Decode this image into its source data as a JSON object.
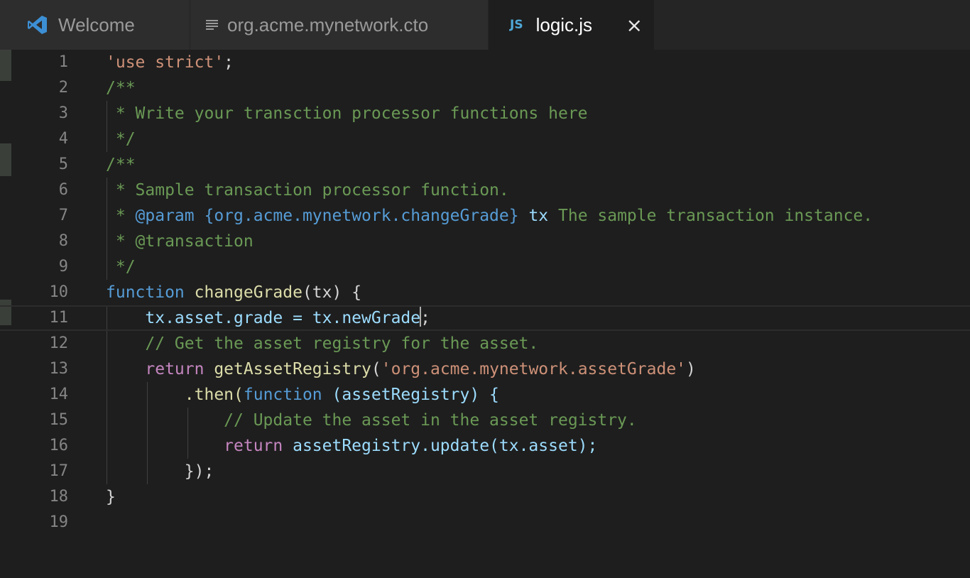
{
  "tabs": [
    {
      "label": "Welcome",
      "icon": "vscode-logo-icon",
      "active": false
    },
    {
      "label": "org.acme.mynetwork.cto",
      "icon": "text-file-icon",
      "active": false
    },
    {
      "label": "logic.js",
      "icon": "js-file-icon",
      "icon_text": "JS",
      "active": true,
      "close": "×"
    }
  ],
  "editor": {
    "line_numbers": [
      "1",
      "2",
      "3",
      "4",
      "5",
      "6",
      "7",
      "8",
      "9",
      "10",
      "11",
      "12",
      "13",
      "14",
      "15",
      "16",
      "17",
      "18",
      "19"
    ],
    "code": {
      "l1_str": "'use strict'",
      "l1_punct": ";",
      "l2": "/**",
      "l3": " * Write your transction processor functions here",
      "l4": " */",
      "l5": "/**",
      "l6": " * Sample transaction processor function.",
      "l7_a": " * ",
      "l7_tag": "@param",
      "l7_type": " {org.acme.mynetwork.changeGrade}",
      "l7_name": " tx",
      "l7_desc": " The sample transaction instance.",
      "l8": " * @transaction",
      "l9": " */",
      "l10_kw": "function",
      "l10_fn": " changeGrade",
      "l10_rest": "(tx) {",
      "l11_a": "    tx.asset.grade = tx.newGrade",
      "l11_b": ";",
      "l12": "    // Get the asset registry for the asset.",
      "l13_ret": "    return",
      "l13_fn": " getAssetRegistry",
      "l13_open": "(",
      "l13_str": "'org.acme.mynetwork.assetGrade'",
      "l13_close": ")",
      "l14_a": "        .then(",
      "l14_kw": "function",
      "l14_b": " (assetRegistry) {",
      "l15": "            // Update the asset in the asset registry.",
      "l16_ret": "            return",
      "l16_b": " assetRegistry.update(tx.asset);",
      "l17": "        });",
      "l18": "}",
      "l19": ""
    }
  }
}
